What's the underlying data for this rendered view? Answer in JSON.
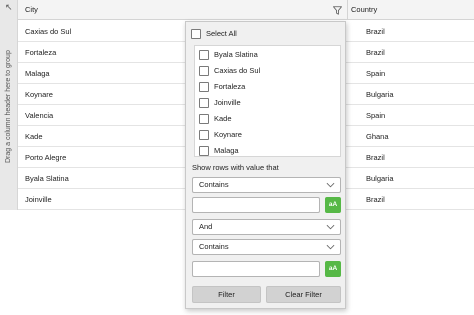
{
  "group_panel": {
    "arrow_icon": "arrow-up-left-icon",
    "text": "Drag a column header here to group"
  },
  "grid": {
    "columns": {
      "city": "City",
      "country": "Country"
    },
    "filter_icon": "funnel-icon",
    "rows": [
      {
        "city": "Caxias do Sul",
        "country": "Brazil"
      },
      {
        "city": "Fortaleza",
        "country": "Brazil"
      },
      {
        "city": "Malaga",
        "country": "Spain"
      },
      {
        "city": "Koynare",
        "country": "Bulgaria"
      },
      {
        "city": "Valencia",
        "country": "Spain"
      },
      {
        "city": "Kade",
        "country": "Ghana"
      },
      {
        "city": "Porto Alegre",
        "country": "Brazil"
      },
      {
        "city": "Byala Slatina",
        "country": "Bulgaria"
      },
      {
        "city": "Joinville",
        "country": "Brazil"
      }
    ]
  },
  "filter_popup": {
    "select_all": "Select All",
    "values": [
      "Byala Slatina",
      "Caxias do Sul",
      "Fortaleza",
      "Joinville",
      "Kade",
      "Koynare",
      "Malaga"
    ],
    "show_rows_label": "Show rows with value that",
    "operator1": "Contains",
    "value1": "",
    "case_button": "aA",
    "logical_operator": "And",
    "operator2": "Contains",
    "value2": "",
    "filter_button": "Filter",
    "clear_button": "Clear Filter",
    "accent_color": "#56b846"
  }
}
